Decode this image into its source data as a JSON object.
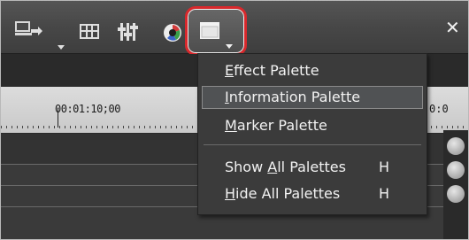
{
  "toolbar": {
    "icons": [
      {
        "name": "output-icon",
        "caret": true
      },
      {
        "name": "grid-icon"
      },
      {
        "name": "audio-mixer-icon"
      },
      {
        "name": "color-correction-icon"
      },
      {
        "name": "palette-window-icon",
        "caret": true
      }
    ],
    "close_glyph": "✕"
  },
  "ruler": {
    "timecode": "00:01:10;00",
    "timecode_next": "0:0"
  },
  "menu": {
    "items": [
      {
        "label": "Effect Palette",
        "mnemonic": "E",
        "shortcut": ""
      },
      {
        "label": "Information Palette",
        "mnemonic": "I",
        "shortcut": ""
      },
      {
        "label": "Marker Palette",
        "mnemonic": "M",
        "shortcut": ""
      },
      {
        "label": "Show All Palettes",
        "mnemonic": "A",
        "shortcut": "H"
      },
      {
        "label": "Hide All Palettes",
        "mnemonic": "H",
        "shortcut": "H"
      }
    ],
    "highlighted_index": 1
  },
  "colors": {
    "highlight_ring": "#d8282c",
    "menu_bg": "#3b3b3b",
    "menu_text": "#f2f2f2"
  }
}
